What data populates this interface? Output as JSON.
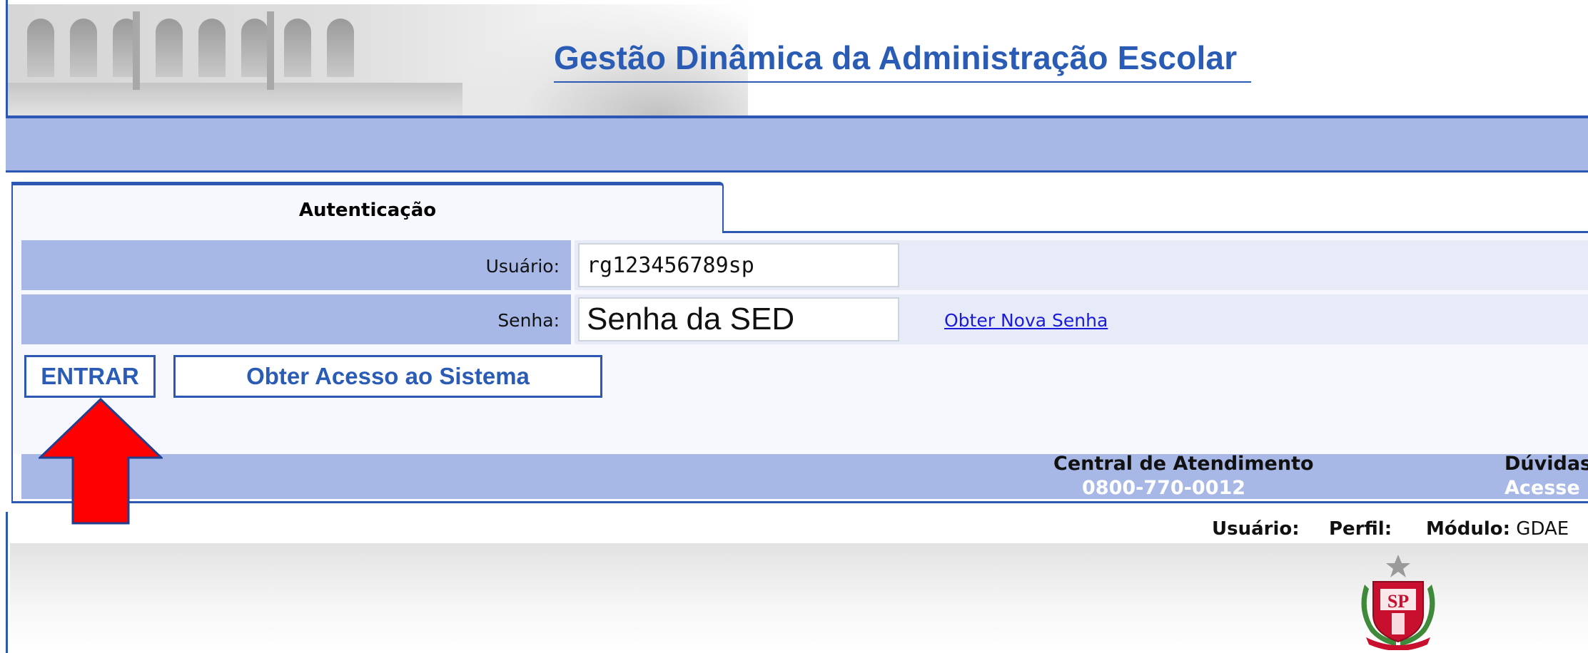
{
  "header": {
    "app_title": "Gestão Dinâmica da Administração Escolar"
  },
  "tab": {
    "label": "Autenticação"
  },
  "form": {
    "user_label": "Usuário:",
    "user_value": "rg123456789sp",
    "password_label": "Senha:",
    "password_placeholder": "Senha da SED",
    "new_password_link": "Obter Nova Senha",
    "enter_button": "ENTRAR",
    "access_button": "Obter Acesso ao Sistema"
  },
  "footer": {
    "support_title": "Central de Atendimento",
    "support_phone": "0800-770-0012",
    "doubts_title": "Dúvidas",
    "doubts_sub": "Acesse"
  },
  "status": {
    "user_label": "Usuário:",
    "profile_label": "Perfil:",
    "module_label": "Módulo:",
    "module_value": "GDAE"
  },
  "colors": {
    "accent_blue": "#2c58b3",
    "title_blue": "#2a5cb5",
    "bar_blue": "#a7b8e6",
    "arrow_red": "#ff0000"
  },
  "icons": {
    "arrow": "red-up-arrow-icon",
    "emblem": "sao-paulo-coat-of-arms-icon"
  }
}
